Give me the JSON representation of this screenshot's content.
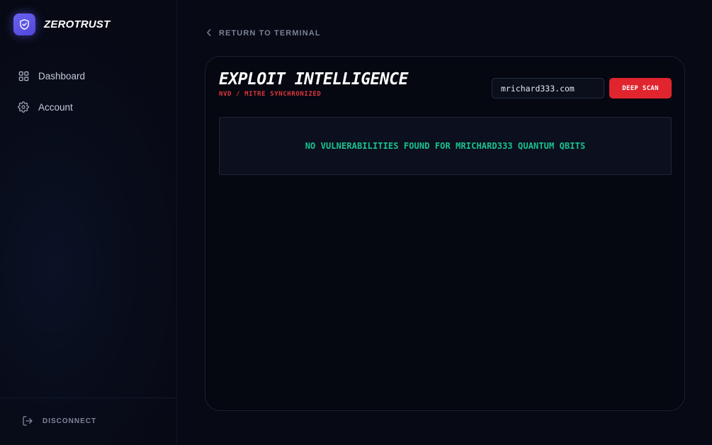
{
  "brand": {
    "name": "ZEROTRUST",
    "logo_icon": "shield-check-icon",
    "accent": "#5b52e8"
  },
  "sidebar": {
    "items": [
      {
        "label": "Dashboard",
        "icon": "grid-icon"
      },
      {
        "label": "Account",
        "icon": "gear-icon"
      }
    ],
    "footer": {
      "label": "DISCONNECT",
      "icon": "logout-icon"
    }
  },
  "nav": {
    "back_label": "RETURN TO TERMINAL",
    "back_icon": "chevron-left-icon"
  },
  "card": {
    "title": "EXPLOIT INTELLIGENCE",
    "subtitle": "NVD / MITRE SYNCHRONIZED",
    "search": {
      "value": "mrichard333.com"
    },
    "scan_button_label": "DEEP SCAN",
    "result_message": "NO VULNERABILITIES FOUND FOR MRICHARD333 QUANTUM QBITS"
  },
  "colors": {
    "danger": "#e0252f",
    "success": "#18c28f",
    "background": "#070914"
  }
}
